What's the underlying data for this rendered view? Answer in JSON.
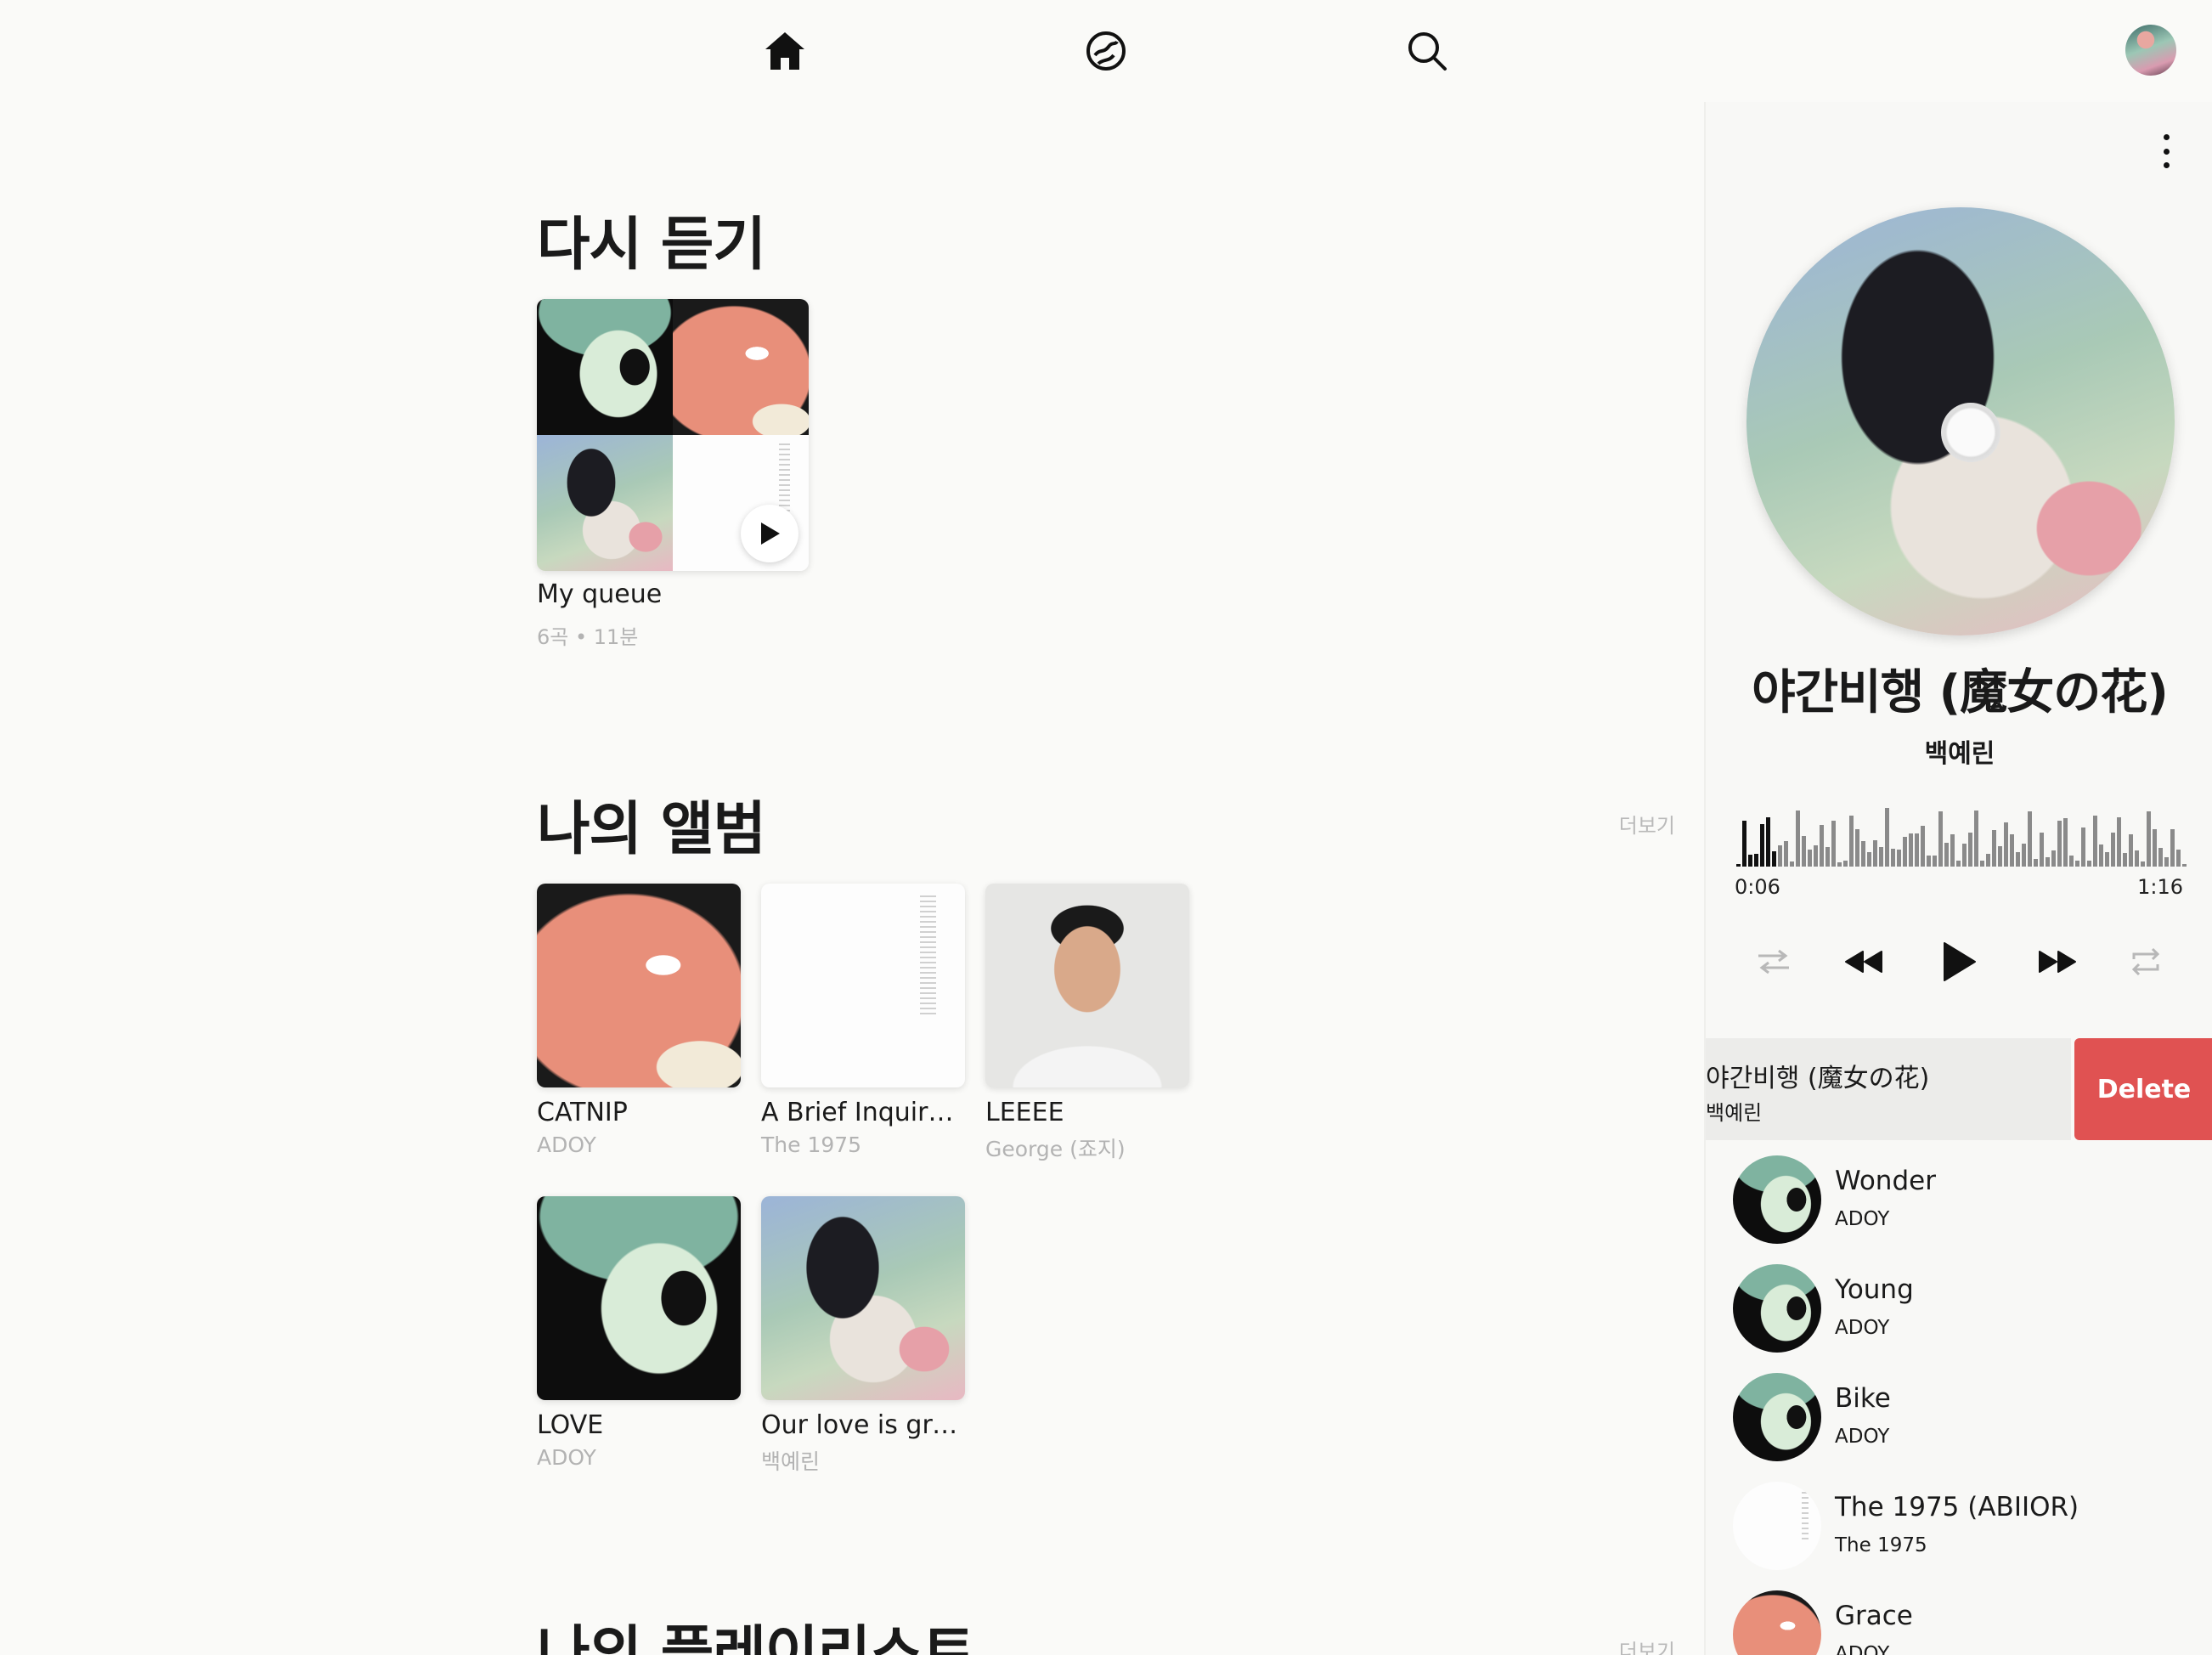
{
  "nav": {
    "icons": [
      "home-icon",
      "explore-icon",
      "search-icon"
    ],
    "avatar": "user-avatar"
  },
  "sections": {
    "listen_again": {
      "title": "다시 듣기"
    },
    "my_albums": {
      "title": "나의 앨범",
      "more": "더보기"
    },
    "my_playlists": {
      "title": "나의 플레이리스트",
      "more": "더보기"
    }
  },
  "queue_card": {
    "title": "My queue",
    "meta": "6곡 • 11분"
  },
  "albums": [
    {
      "title": "CATNIP",
      "artist": "ADOY"
    },
    {
      "title": "A Brief Inquiry Into Online Relationships",
      "artist": "The 1975"
    },
    {
      "title": "LEEEE",
      "artist": "George (죠지)"
    },
    {
      "title": "LOVE",
      "artist": "ADOY"
    },
    {
      "title": "Our love is great",
      "artist": "백예린"
    }
  ],
  "now_playing": {
    "title": "야간비행 (魔女の花)",
    "artist": "백예린",
    "elapsed": "0:06",
    "duration": "1:16",
    "progress": 0.08
  },
  "queue": {
    "swiped": {
      "title": "야간비행 (魔女の花)",
      "artist": "백예린",
      "delete_label": "Delete"
    },
    "items": [
      {
        "title": "Wonder",
        "artist": "ADOY"
      },
      {
        "title": "Young",
        "artist": "ADOY"
      },
      {
        "title": "Bike",
        "artist": "ADOY"
      },
      {
        "title": "The 1975 (ABIIOR)",
        "artist": "The 1975"
      },
      {
        "title": "Grace",
        "artist": "ADOY"
      }
    ]
  },
  "colors": {
    "background": "#fafaf8",
    "delete": "#e05252",
    "muted": "#b3b3b3"
  }
}
